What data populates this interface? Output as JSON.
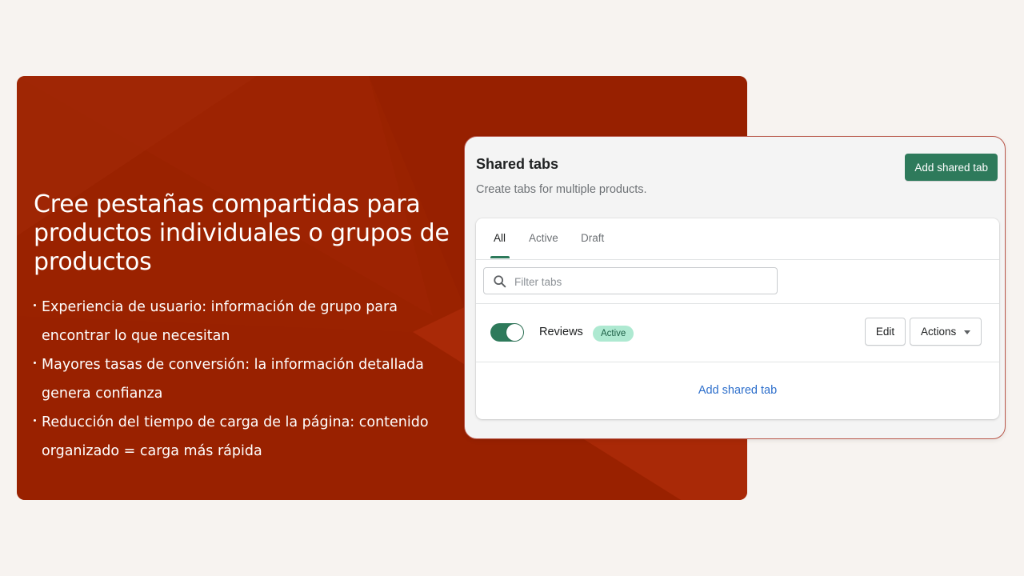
{
  "hero": {
    "title": "Cree pestañas compartidas para productos individuales o grupos de productos",
    "bullets": [
      "Experiencia de usuario: información de grupo para encontrar lo que necesitan",
      "Mayores tasas de conversión: la información detallada genera confianza",
      "Reducción del tiempo de carga de la página: contenido organizado = carga más rápida"
    ]
  },
  "card": {
    "title": "Shared tabs",
    "subtitle": "Create tabs for multiple products.",
    "primary_button": "Add shared tab",
    "tabs": [
      {
        "label": "All",
        "selected": true
      },
      {
        "label": "Active",
        "selected": false
      },
      {
        "label": "Draft",
        "selected": false
      }
    ],
    "search": {
      "placeholder": "Filter tabs",
      "value": "",
      "icon": "search-icon"
    },
    "rows": [
      {
        "name": "Reviews",
        "status": "Active",
        "enabled": true,
        "edit_label": "Edit",
        "actions_label": "Actions"
      }
    ],
    "add_link": "Add shared tab"
  },
  "colors": {
    "brand_red": "#9a2200",
    "accent_green": "#2e7a5b",
    "badge_bg": "#aee9d1",
    "link_blue": "#2c6ecb",
    "page_bg": "#f7f3f0"
  }
}
